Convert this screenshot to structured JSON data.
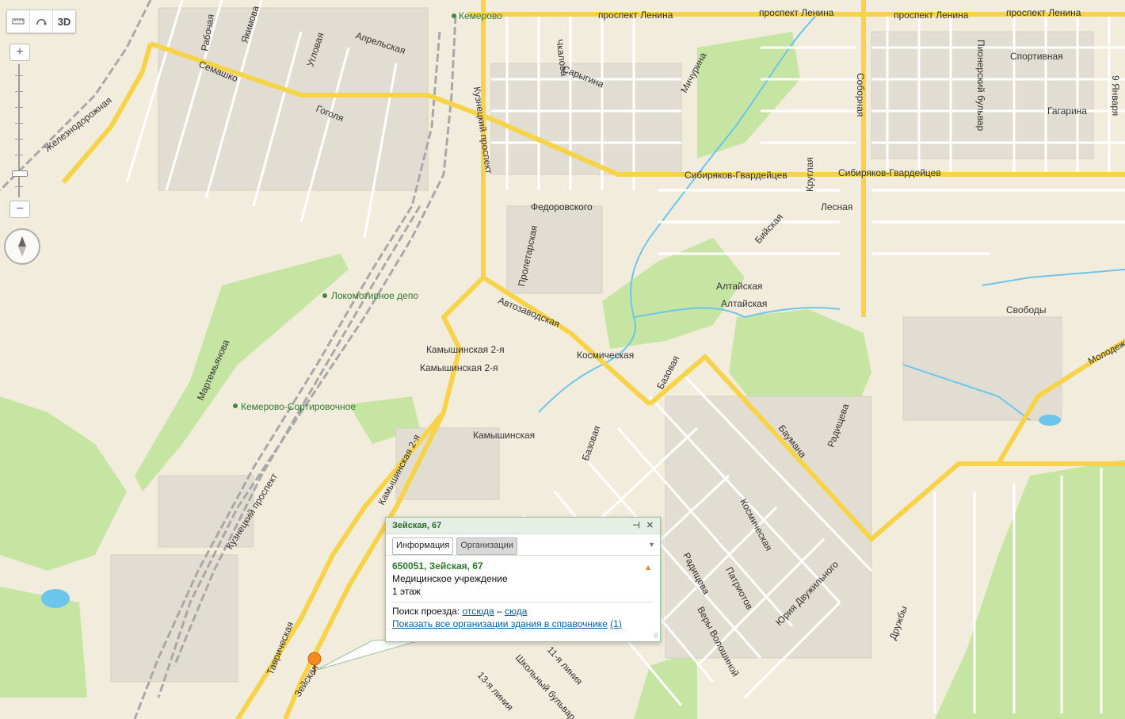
{
  "toolbar": {
    "ruler_icon": "ruler-icon",
    "route_icon": "route-icon",
    "mode_3d_label": "3D"
  },
  "zoom": {
    "plus": "+",
    "minus": "−"
  },
  "map": {
    "streets": [
      "проспект Ленина",
      "проспект Ленина",
      "проспект Ленина",
      "проспект Ленина",
      "Сибиряков-Гвардейцев",
      "Сибиряков-Гвардейцев",
      "Рабочая",
      "Якимова",
      "Апрельская",
      "Угловая",
      "Семашко",
      "Гоголя",
      "Железнодорожная",
      "Кузнецкий проспект",
      "Чкалова",
      "Сарыгина",
      "Мичурина",
      "Соборная",
      "Пионерский бульвар",
      "9 Января",
      "Спортивная",
      "Гагарина",
      "Федоровского",
      "Пролетарская",
      "Круглая",
      "Лесная",
      "Бийская",
      "Алтайская",
      "Алтайская",
      "Свободы",
      "Автозаводская",
      "Космическая",
      "Камышинская 2-я",
      "Камышинская 2-я",
      "Камышинская",
      "Базовая",
      "Базовая",
      "Баумана",
      "Радищева",
      "Молодежный",
      "Мартемьянова",
      "Кузнецкий проспект",
      "Камышинская 2-я",
      "Таврическая",
      "Зейская",
      "Космическая",
      "Радищева",
      "Патриотов",
      "Юрия Двужильного",
      "Веры Волошиной",
      "Дружбы",
      "11-я линия",
      "13-я линия",
      "Школьный бульвар"
    ],
    "pois": [
      "Кемерово",
      "Локомотивное депо",
      "Кемерово-Сортировочное"
    ]
  },
  "balloon": {
    "header": "Зейская, 67",
    "tab_info": "Информация",
    "tab_orgs": "Организации",
    "title": "650051, Зейская, 67",
    "category": "Медицинское учреждение",
    "floors": "1 этаж",
    "route_label": "Поиск проезда:",
    "route_from": "отсюда",
    "route_dash": "–",
    "route_to": "сюда",
    "all_orgs_link": "Показать все организации здания в справочнике",
    "all_orgs_count": "(1)"
  },
  "colors": {
    "major_road": "#f7d34a",
    "minor_road": "#ffffff",
    "park": "#bfe29a",
    "water": "#6cc6ec",
    "land": "#f2ecdc",
    "railway": "#a8a8a8"
  }
}
